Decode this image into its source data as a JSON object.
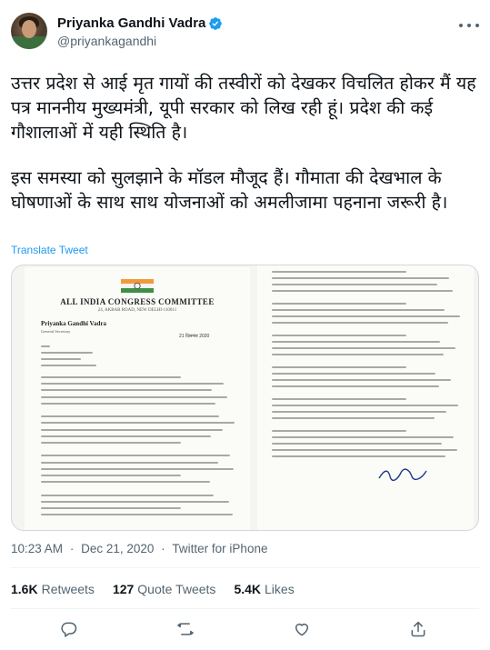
{
  "author": {
    "display_name": "Priyanka Gandhi Vadra",
    "handle": "@priyankagandhi"
  },
  "tweet": {
    "paragraphs": [
      "उत्तर प्रदेश से आई मृत गायों की तस्वीरों को देखकर विचलित होकर मैं यह पत्र माननीय मुख्यमंत्री, यूपी सरकार को लिख रही हूं। प्रदेश की कई गौशालाओं में यही स्थिति है।",
      "इस समस्या को सुलझाने के मॉडल मौजूद हैं। गौमाता की देखभाल के घोषणाओं के साथ साथ योजनाओं को अमलीजामा पहनाना जरूरी है।"
    ],
    "translate_label": "Translate Tweet"
  },
  "letter": {
    "org_name": "ALL INDIA CONGRESS COMMITTEE",
    "address": "24, AKBAR ROAD, NEW DELHI-110011",
    "sender": "Priyanka Gandhi Vadra",
    "sender_title": "General Secretary",
    "date": "21 दिसम्बर 2020"
  },
  "meta": {
    "time": "10:23 AM",
    "separator": "·",
    "date": "Dec 21, 2020",
    "source": "Twitter for iPhone"
  },
  "stats": {
    "retweets_count": "1.6K",
    "retweets_label": "Retweets",
    "quotes_count": "127",
    "quotes_label": "Quote Tweets",
    "likes_count": "5.4K",
    "likes_label": "Likes"
  },
  "icons": {
    "more": "more-icon",
    "verified": "verified-icon",
    "reply": "reply-icon",
    "retweet": "retweet-icon",
    "like": "heart-icon",
    "share": "share-icon"
  },
  "colors": {
    "accent": "#1d9bf0",
    "text": "#0f1419",
    "secondary": "#536471"
  }
}
